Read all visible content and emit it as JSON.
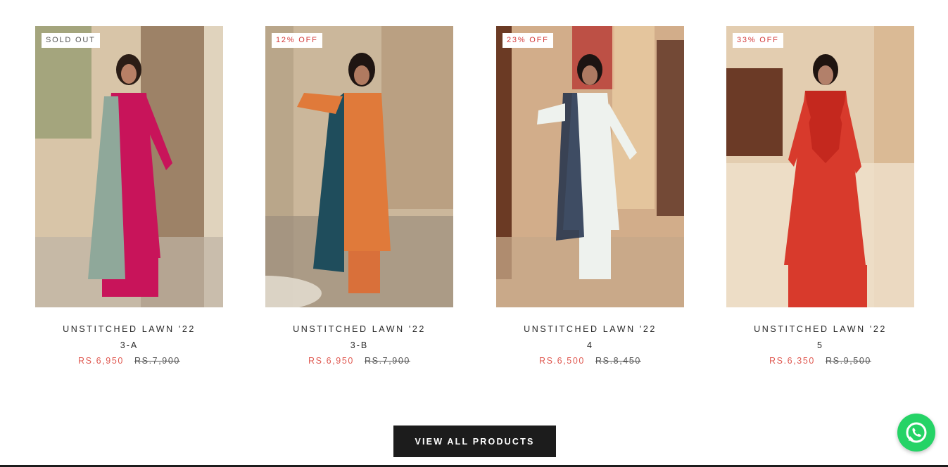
{
  "products": [
    {
      "badge": "SOLD OUT",
      "badge_type": "soldout",
      "title": "UNSTITCHED LAWN '22",
      "variant": "3-A",
      "price": "RS.6,950",
      "compare_price": "RS.7,900",
      "outfit_color": "#c8145a",
      "scarf_color": "#8fa89a",
      "bg_color": "#d8c5a8"
    },
    {
      "badge": "12% OFF",
      "badge_type": "sale",
      "title": "UNSTITCHED LAWN '22",
      "variant": "3-B",
      "price": "RS.6,950",
      "compare_price": "RS.7,900",
      "outfit_color": "#e07a3a",
      "scarf_color": "#1f4d5c",
      "bg_color": "#cbb79b"
    },
    {
      "badge": "23% OFF",
      "badge_type": "sale",
      "title": "UNSTITCHED LAWN '22",
      "variant": "4",
      "price": "RS.6,500",
      "compare_price": "RS.8,450",
      "outfit_color": "#eef2ee",
      "scarf_color": "#1f2f4a",
      "bg_color": "#d2ad8a"
    },
    {
      "badge": "33% OFF",
      "badge_type": "sale",
      "title": "UNSTITCHED LAWN '22",
      "variant": "5",
      "price": "RS.6,350",
      "compare_price": "RS.9,500",
      "outfit_color": "#d83a2c",
      "scarf_color": "#c4281e",
      "bg_color": "#e3cdb0"
    }
  ],
  "cta": {
    "label": "VIEW ALL PRODUCTS"
  },
  "chat": {
    "icon": "whatsapp-icon",
    "color": "#25d366"
  }
}
